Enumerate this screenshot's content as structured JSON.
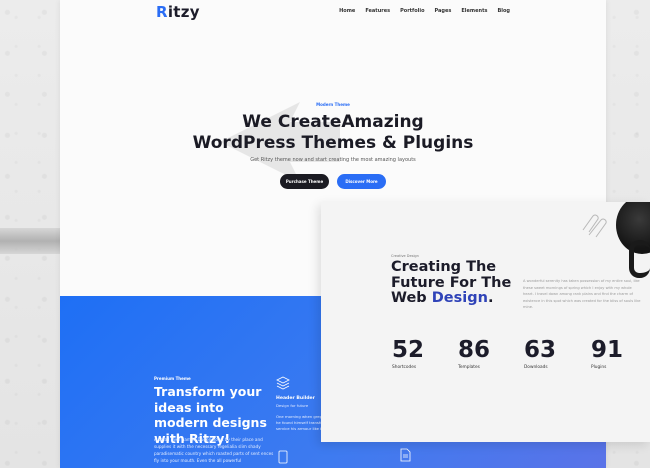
{
  "nav": {
    "logo_initial": "R",
    "logo_rest": "itzy",
    "menu": [
      "Home",
      "Features",
      "Portfolio",
      "Pages",
      "Elements",
      "Blog"
    ]
  },
  "hero": {
    "tag": "Modern Theme",
    "title_line1": "We CreateAmazing",
    "title_line2": "WordPress Themes & Plugins",
    "subtitle": "Get Ritzy theme now and start creating the most amazing layouts",
    "btn_purchase": "Purchase Theme",
    "btn_discover": "Discover More"
  },
  "band": {
    "tag": "Premium Theme",
    "title": "Transform your ideas into modern designs with Ritzy!",
    "text": "A small river named Duden flows by their place and supplies it with the necessary regelialia slim shady paradisematic country which roasted parts of sent ences fly into your mouth. Even the all powerful",
    "feature1_title": "Header Builder",
    "feature1_sub": "Design for future",
    "feature_text": "One morning when gregor samsa woke from troubled dreams, he found himself transformed in his bed into a premium service his armour like back."
  },
  "card": {
    "tag": "Creative Design",
    "title_l1": "Creating The",
    "title_l2": "Future For The",
    "title_l3a": "Web ",
    "title_hl": "Design",
    "title_l3b": ".",
    "para": "A wonderful serenity has taken possession of my entire soul, like these sweet mornings of spring which I enjoy with my whole heart. I travel down among rank plains and find the charm of existence in this spot which was created for the bliss of souls like mine.",
    "stats": [
      {
        "num": "52",
        "label": "Shortcodes"
      },
      {
        "num": "86",
        "label": "Templates"
      },
      {
        "num": "63",
        "label": "Downloads"
      },
      {
        "num": "91",
        "label": "Plugins"
      }
    ]
  },
  "colors": {
    "accent": "#2a6df5",
    "dark": "#1b1b22",
    "highlight": "#2f43b8"
  }
}
